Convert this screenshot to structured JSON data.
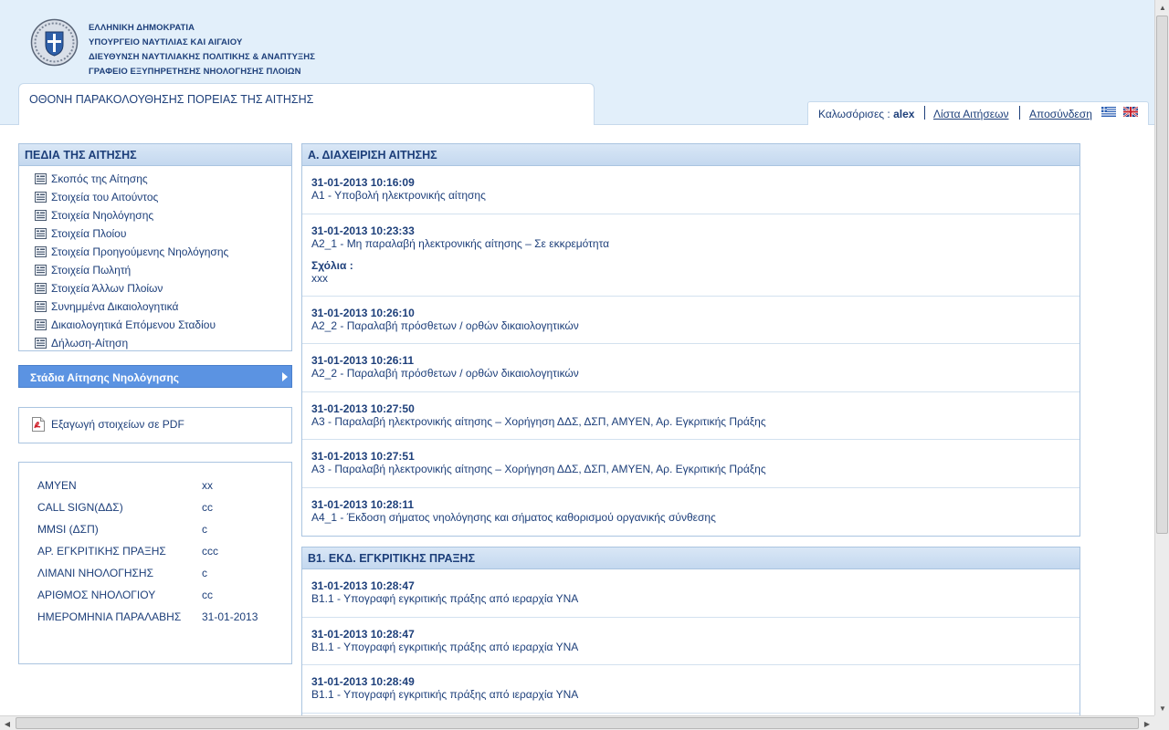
{
  "header": {
    "org_lines": [
      "ΕΛΛΗΝΙΚΗ ΔΗΜΟΚΡΑΤΙΑ",
      "ΥΠΟΥΡΓΕΙΟ ΝΑΥΤΙΛΙΑΣ ΚΑΙ ΑΙΓΑΙΟΥ",
      "ΔΙΕΥΘΥΝΣΗ ΝΑΥΤΙΛΙΑΚΗΣ ΠΟΛΙΤΙΚΗΣ & ΑΝΑΠΤΥΞΗΣ",
      "ΓΡΑΦΕΙΟ ΕΞΥΠΗΡΕΤΗΣΗΣ ΝΗΟΛΟΓΗΣΗΣ ΠΛΟΙΩΝ"
    ],
    "page_title": "ΟΘΟΝΗ ΠΑΡΑΚΟΛΟΥΘΗΣΗΣ ΠΟΡΕΙΑΣ ΤΗΣ ΑΙΤΗΣΗΣ"
  },
  "userbar": {
    "welcome_label": "Καλωσόρισες : ",
    "username": "alex",
    "applications_link": "Λίστα Αιτήσεων",
    "logout_link": "Αποσύνδεση"
  },
  "fields_panel": {
    "title": "ΠΕΔΙΑ ΤΗΣ ΑΙΤΗΣΗΣ",
    "items": [
      "Σκοπός της Αίτησης",
      "Στοιχεία του Αιτούντος",
      "Στοιχεία Νηολόγησης",
      "Στοιχεία Πλοίου",
      "Στοιχεία Προηγούμενης Νηολόγησης",
      "Στοιχεία Πωλητή",
      "Στοιχεία Άλλων Πλοίων",
      "Συνημμένα Δικαιολογητικά",
      "Δικαιολογητικά Επόμενου Σταδίου",
      "Δήλωση-Αίτηση"
    ]
  },
  "stages_button": {
    "label": "Στάδια Αίτησης Νηολόγησης"
  },
  "pdf_export": {
    "label": "Εξαγωγή στοιχείων σε PDF"
  },
  "info": {
    "rows": [
      {
        "key": "ΑΜΥΕΝ",
        "value": "xx"
      },
      {
        "key": "CALL SIGN(ΔΔΣ)",
        "value": "cc"
      },
      {
        "key": "MMSI (ΔΣΠ)",
        "value": "c"
      },
      {
        "key": "ΑΡ. ΕΓΚΡΙΤΙΚΗΣ ΠΡΑΞΗΣ",
        "value": "ccc"
      },
      {
        "key": "ΛΙΜΑΝΙ ΝΗΟΛΟΓΗΣΗΣ",
        "value": "c"
      },
      {
        "key": "ΑΡΙΘΜΟΣ ΝΗΟΛΟΓΙΟΥ",
        "value": "cc"
      },
      {
        "key": "ΗΜΕΡΟΜΗΝΙΑ ΠΑΡΑΛΑΒΗΣ",
        "value": "31-01-2013"
      }
    ]
  },
  "section_a": {
    "title": "Α. ΔΙΑΧΕΙΡΙΣΗ ΑΙΤΗΣΗΣ",
    "entries": [
      {
        "timestamp": "31-01-2013 10:16:09",
        "description": "Α1 - Υποβολή ηλεκτρονικής αίτησης"
      },
      {
        "timestamp": "31-01-2013 10:23:33",
        "description": "Α2_1 - Μη παραλαβή ηλεκτρονικής αίτησης – Σε εκκρεμότητα",
        "comments_label": "Σχόλια :",
        "comments": "xxx"
      },
      {
        "timestamp": "31-01-2013 10:26:10",
        "description": "Α2_2 - Παραλαβή πρόσθετων / ορθών δικαιολογητικών"
      },
      {
        "timestamp": "31-01-2013 10:26:11",
        "description": "Α2_2 - Παραλαβή πρόσθετων / ορθών δικαιολογητικών"
      },
      {
        "timestamp": "31-01-2013 10:27:50",
        "description": "Α3 - Παραλαβή ηλεκτρονικής αίτησης – Χορήγηση ΔΔΣ, ΔΣΠ, ΑΜΥΕΝ, Αρ. Εγκριτικής Πράξης"
      },
      {
        "timestamp": "31-01-2013 10:27:51",
        "description": "Α3 - Παραλαβή ηλεκτρονικής αίτησης – Χορήγηση ΔΔΣ, ΔΣΠ, ΑΜΥΕΝ, Αρ. Εγκριτικής Πράξης"
      },
      {
        "timestamp": "31-01-2013 10:28:11",
        "description": "Α4_1 - Έκδοση σήματος νηολόγησης και σήματος καθορισμού οργανικής σύνθεσης"
      }
    ]
  },
  "section_b": {
    "title": "Β1. ΕΚΔ. ΕΓΚΡΙΤΙΚΗΣ ΠΡΑΞΗΣ",
    "entries": [
      {
        "timestamp": "31-01-2013 10:28:47",
        "description": "Β1.1 - Υπογραφή εγκριτικής πράξης από ιεραρχία ΥΝΑ"
      },
      {
        "timestamp": "31-01-2013 10:28:47",
        "description": "Β1.1 - Υπογραφή εγκριτικής πράξης από ιεραρχία ΥΝΑ"
      },
      {
        "timestamp": "31-01-2013 10:28:49",
        "description": "Β1.1 - Υπογραφή εγκριτικής πράξης από ιεραρχία ΥΝΑ"
      }
    ]
  },
  "icons": {
    "logo": "greek-coat-of-arms-icon",
    "field_item": "document-lines-icon",
    "pdf": "pdf-file-icon",
    "flag_gr": "greek-flag-icon",
    "flag_uk": "uk-flag-icon"
  },
  "colors": {
    "header_bg": "#e2effa",
    "text_blue": "#1d3f7a",
    "accent_button": "#5b93e2",
    "panel_border": "#aac4e0"
  }
}
